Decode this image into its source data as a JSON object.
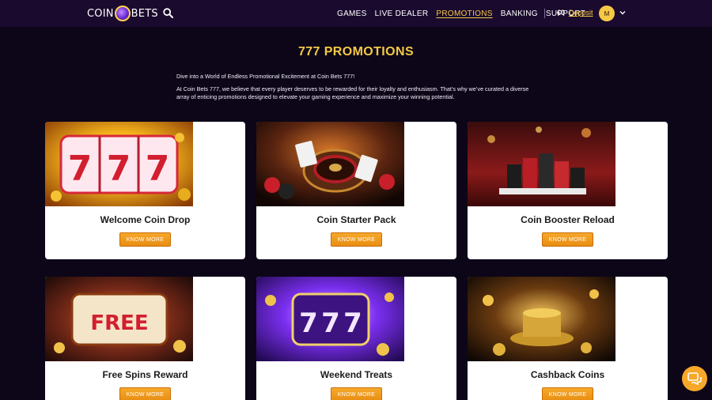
{
  "header": {
    "logo_left": "COIN",
    "logo_right": "BETS",
    "nav": [
      {
        "label": "GAMES",
        "active": false
      },
      {
        "label": "LIVE DEALER",
        "active": false
      },
      {
        "label": "PROMOTIONS",
        "active": true
      },
      {
        "label": "BANKING",
        "active": false
      },
      {
        "label": "SUPPORT",
        "active": false
      }
    ],
    "balance": "€0",
    "deposit_label": "Deposit",
    "avatar_initial": "M"
  },
  "page": {
    "title": "777 PROMOTIONS",
    "intro_1": "Dive into a World of Endless Promotional Excitement at Coin Bets 777!",
    "intro_2": "At Coin Bets 777, we believe that every player deserves to be rewarded for their loyalty and enthusiasm. That’s why we’ve curated a diverse array of enticing promotions designed to elevate your gaming experience and maximize your winning potential."
  },
  "promotions": [
    {
      "title": "Welcome Coin Drop",
      "button": "KNOW MORE"
    },
    {
      "title": "Coin Starter Pack",
      "button": "KNOW MORE"
    },
    {
      "title": "Coin Booster Reload",
      "button": "KNOW MORE"
    },
    {
      "title": "Free Spins Reward",
      "button": "KNOW MORE"
    },
    {
      "title": "Weekend Treats",
      "button": "KNOW MORE"
    },
    {
      "title": "Cashback Coins",
      "button": "KNOW MORE"
    }
  ],
  "icons": {
    "search": "search-icon",
    "chevron": "chevron-down-icon",
    "chat": "chat-icon"
  },
  "colors": {
    "accent": "#f6c945",
    "button": "#f7a82a",
    "header_bg": "#1a0a2e",
    "page_bg": "#0c0618"
  }
}
